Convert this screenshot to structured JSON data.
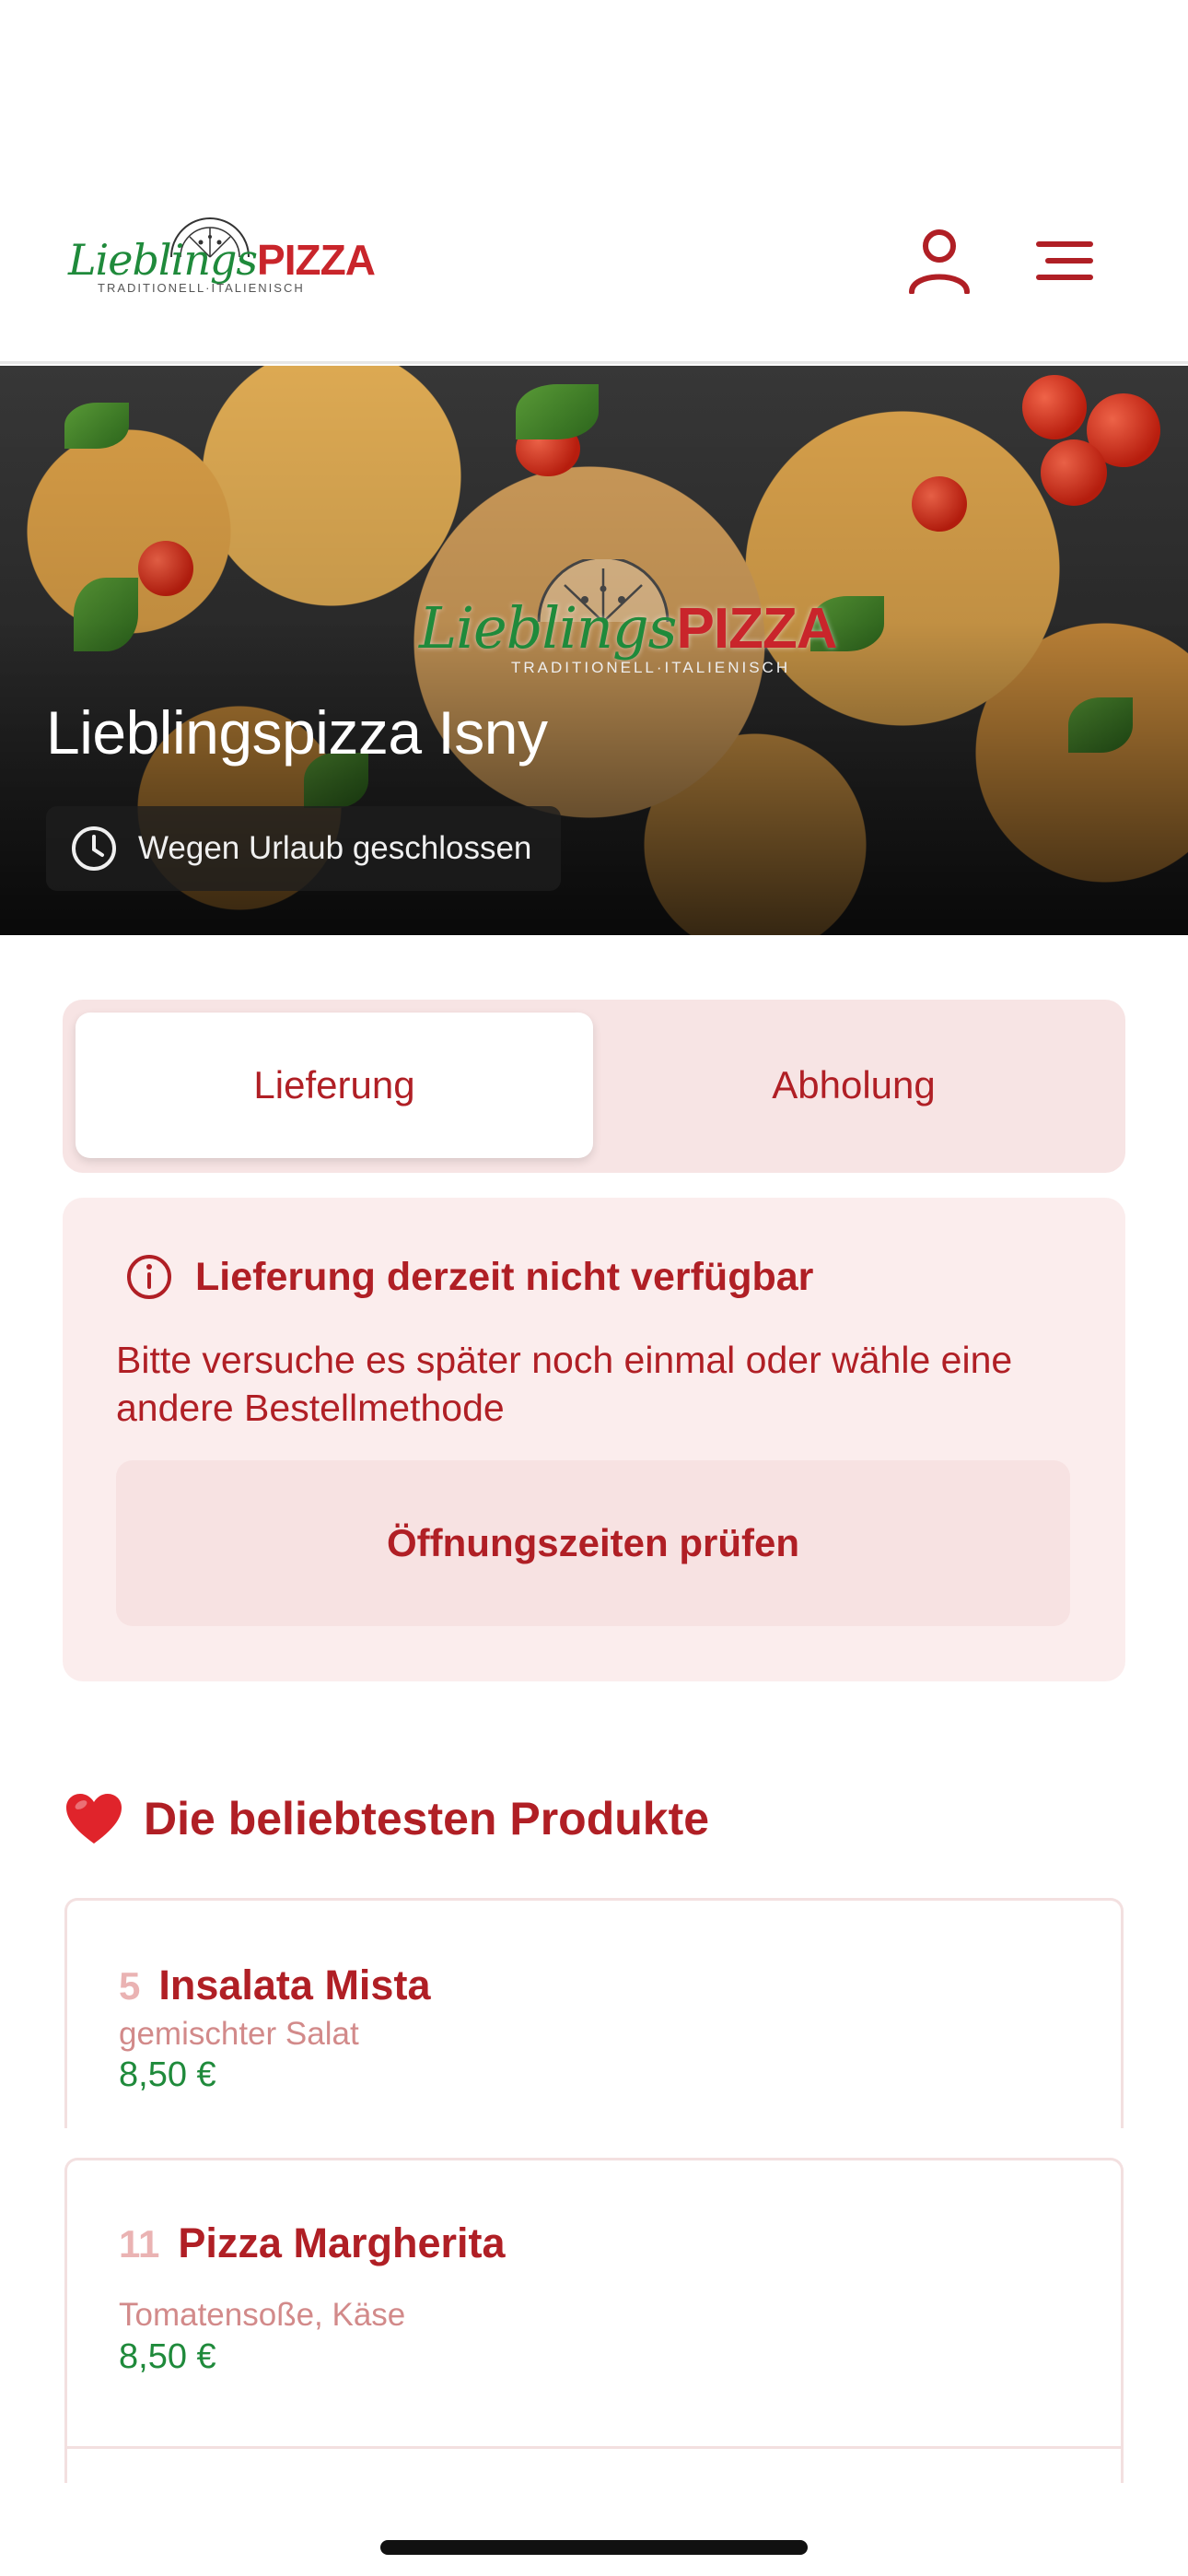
{
  "header": {
    "logo": {
      "wordmark_script": "Lieblings",
      "wordmark_bold": "PIZZA",
      "tagline": "TRADITIONELL·ITALIENISCH"
    },
    "icons": {
      "user": "user-icon",
      "menu": "menu-icon"
    },
    "colors": {
      "brand_red": "#b01f25",
      "brand_green": "#1f8a3b"
    }
  },
  "hero": {
    "title": "Lieblingspizza Isny",
    "status": "Wegen Urlaub geschlossen",
    "status_icon": "clock-icon"
  },
  "order_mode": {
    "options": [
      "Lieferung",
      "Abholung"
    ],
    "selected": "Lieferung"
  },
  "notice": {
    "icon": "info-icon",
    "title": "Lieferung derzeit nicht verfügbar",
    "body": "Bitte versuche es später noch einmal oder wähle eine andere Bestellmethode",
    "button": "Öffnungszeiten prüfen"
  },
  "popular": {
    "emoji": "❤️",
    "title": "Die beliebtesten Produkte",
    "items": [
      {
        "number": "5",
        "name": "Insalata Mista",
        "description": "gemischter Salat",
        "price": "8,50 €"
      },
      {
        "number": "11",
        "name": "Pizza Margherita",
        "description": "Tomatensoße, Käse",
        "price": "8,50 €"
      }
    ]
  }
}
